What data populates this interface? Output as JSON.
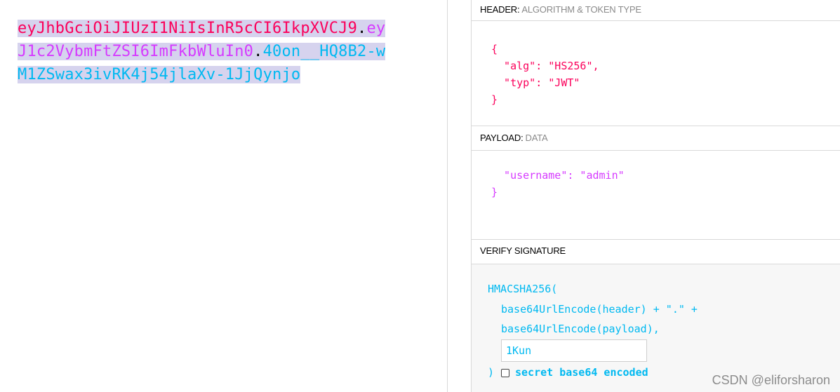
{
  "encoded": {
    "header": "eyJhbGciOiJIUzI1NiIsInR5cCI6IkpXVCJ9",
    "dot1": ".",
    "payload": "eyJ1c2VybmFtZSI6ImFkbWluIn0",
    "dot2": ".",
    "signature": "40on__HQ8B2-wM1ZSwax3ivRK4j54jlaXv-1JjQynjo"
  },
  "header_section": {
    "title": "HEADER:",
    "subtitle": "ALGORITHM & TOKEN TYPE",
    "lines": [
      "{",
      "  \"alg\": \"HS256\",",
      "  \"typ\": \"JWT\"",
      "}"
    ]
  },
  "payload_section": {
    "title": "PAYLOAD:",
    "subtitle": "DATA",
    "lines": [
      "  \"username\": \"admin\"",
      "}"
    ]
  },
  "verify_section": {
    "title": "VERIFY SIGNATURE",
    "fn_open": "HMACSHA256(",
    "line1": "base64UrlEncode(header) + \".\" +",
    "line2": "base64UrlEncode(payload),",
    "secret_value": "1Kun",
    "close": ")",
    "checkbox_label": "secret base64 encoded",
    "checkbox_checked": false
  },
  "watermark": "CSDN @eliforsharon",
  "colors": {
    "header": "#fb015b",
    "payload": "#d63aff",
    "signature": "#00b9f1",
    "selection": "#d6d3ee"
  }
}
